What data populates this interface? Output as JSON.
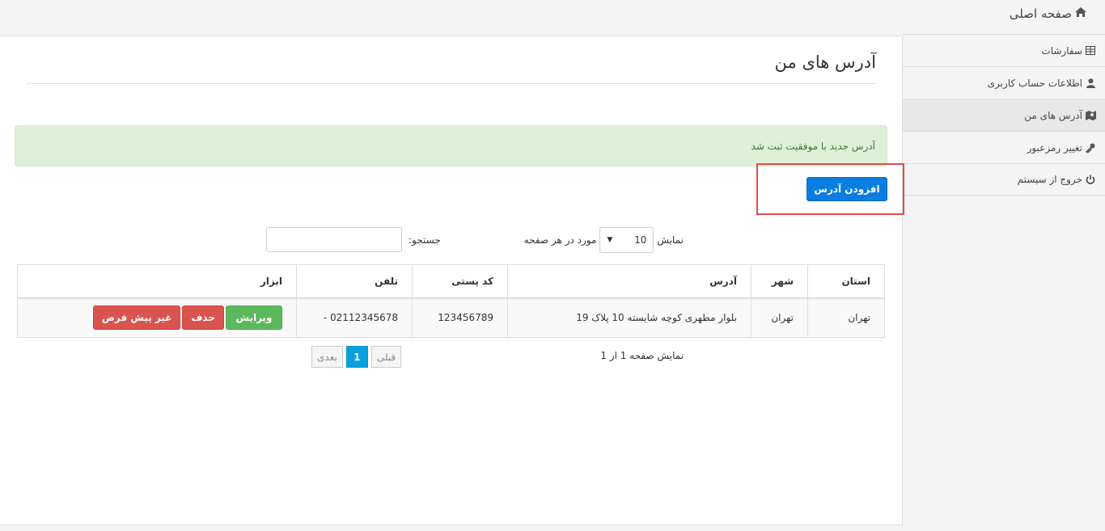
{
  "sidebar": {
    "home_label": "صفحه اصلی",
    "items": [
      {
        "label": "سفارشات",
        "icon": "table-icon"
      },
      {
        "label": "اطلاعات حساب کاربری",
        "icon": "user-icon"
      },
      {
        "label": "آدرس های من",
        "icon": "map-icon",
        "active": true
      },
      {
        "label": "تغییر رمزعبور",
        "icon": "key-icon"
      },
      {
        "label": "خروج از سیستم",
        "icon": "power-icon"
      }
    ]
  },
  "main": {
    "title": "آدرس های من",
    "alert": "آدرس جدید با موفقیت ثبت شد",
    "add_button": "افزودن آدرس",
    "length": {
      "prefix": "نمایش",
      "value": "10",
      "suffix": "مورد در هر صفحه"
    },
    "search_label": "جستجو:",
    "table": {
      "headers": [
        "استان",
        "شهر",
        "آدرس",
        "کد پستی",
        "تلفن",
        "ابزار"
      ],
      "rows": [
        {
          "province": "تهران",
          "city": "تهران",
          "address": "بلوار مطهری کوچه شایسته 10 پلاک 19",
          "postal": "123456789",
          "phone": "02112345678 -",
          "actions": {
            "edit": "ویرایش",
            "delete": "حذف",
            "default": "غیر پیش فرض"
          }
        }
      ]
    },
    "info": "نمایش صفحه 1 از 1",
    "pager": {
      "prev": "قبلی",
      "current": "1",
      "next": "بعدی"
    }
  },
  "colors": {
    "primary": "#0a7de0",
    "success": "#5cb85c",
    "danger": "#d9534f",
    "alert_bg": "#dff0d8",
    "highlight": "#e24a4a"
  }
}
